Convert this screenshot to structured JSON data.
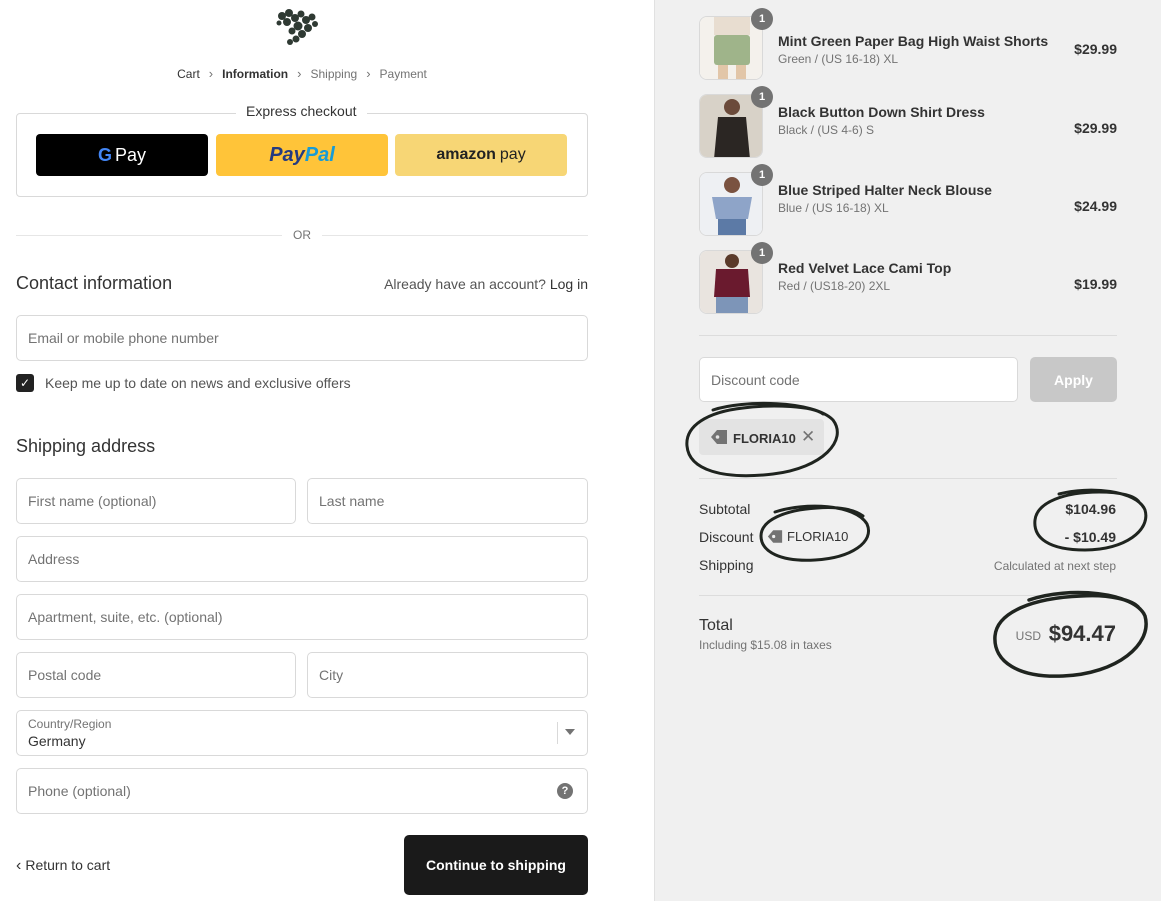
{
  "breadcrumb": {
    "items": [
      "Cart",
      "Information",
      "Shipping",
      "Payment"
    ]
  },
  "express": {
    "title": "Express checkout",
    "gpay_label": "Pay",
    "paypal_label_1": "Pay",
    "paypal_label_2": "Pal",
    "amazon_label_1": "amazon",
    "amazon_label_2": "pay"
  },
  "divider_or": "OR",
  "contact": {
    "title": "Contact information",
    "account_prompt": "Already have an account?",
    "login_label": "Log in",
    "email_placeholder": "Email or mobile phone number",
    "newsletter_label": "Keep me up to date on news and exclusive offers",
    "newsletter_checked": true
  },
  "shipping": {
    "title": "Shipping address",
    "first_name_placeholder": "First name (optional)",
    "last_name_placeholder": "Last name",
    "address_placeholder": "Address",
    "apartment_placeholder": "Apartment, suite, etc. (optional)",
    "postal_placeholder": "Postal code",
    "city_placeholder": "City",
    "country_label": "Country/Region",
    "country_value": "Germany",
    "phone_placeholder": "Phone (optional)"
  },
  "footer": {
    "return_label": "Return to cart",
    "continue_label": "Continue to shipping"
  },
  "order": {
    "items": [
      {
        "name": "Mint Green Paper Bag High Waist Shorts",
        "variant": "Green / (US 16-18) XL",
        "price": "$29.99",
        "qty": "1",
        "thumb_color": "#9fb48a"
      },
      {
        "name": "Black Button Down Shirt Dress",
        "variant": "Black / (US 4-6) S",
        "price": "$29.99",
        "qty": "1",
        "thumb_color": "#2b2623"
      },
      {
        "name": "Blue Striped Halter Neck Blouse",
        "variant": "Blue / (US 16-18) XL",
        "price": "$24.99",
        "qty": "1",
        "thumb_color": "#8ea4c8"
      },
      {
        "name": "Red Velvet Lace Cami Top",
        "variant": "Red / (US18-20) 2XL",
        "price": "$19.99",
        "qty": "1",
        "thumb_color": "#6a1a2e"
      }
    ],
    "discount_placeholder": "Discount code",
    "apply_label": "Apply",
    "applied_code": "FLORIA10",
    "subtotal_label": "Subtotal",
    "subtotal_value": "$104.96",
    "discount_label": "Discount",
    "discount_code_inline": "FLORIA10",
    "discount_value": "- $10.49",
    "shipping_label": "Shipping",
    "shipping_value": "Calculated at next step",
    "total_label": "Total",
    "total_taxes": "Including $15.08 in taxes",
    "currency": "USD",
    "total_value": "$94.47"
  }
}
